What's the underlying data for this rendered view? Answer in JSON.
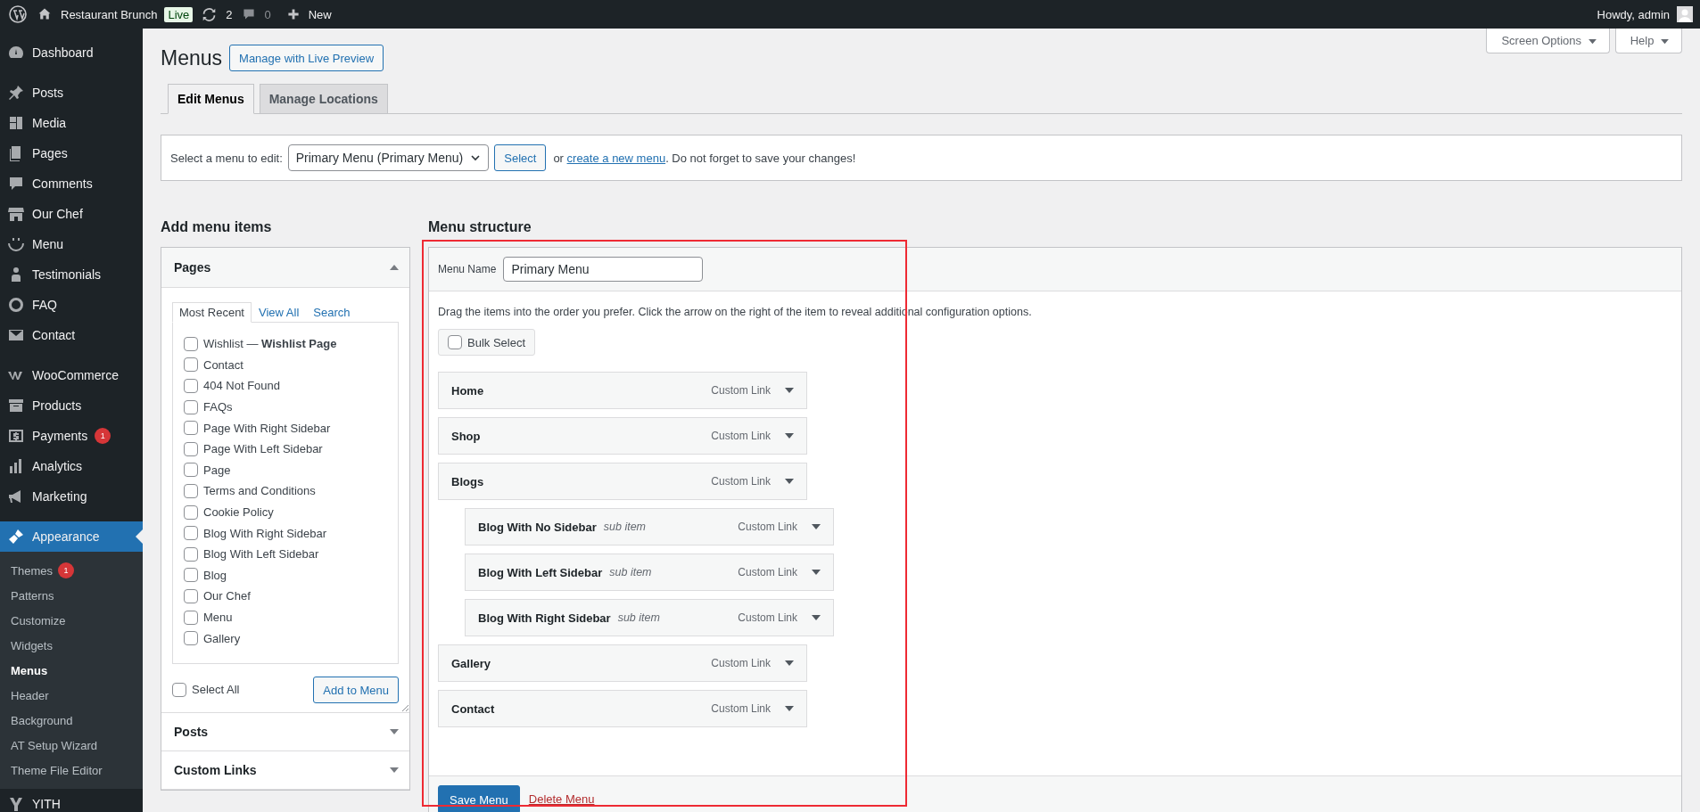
{
  "admin_bar": {
    "site_name": "Restaurant Brunch",
    "live_badge": "Live",
    "updates_count": "2",
    "comments_count": "0",
    "new_label": "New",
    "greeting": "Howdy, admin"
  },
  "sidebar": {
    "sections": [
      {
        "items": [
          {
            "label": "Dashboard",
            "selected": false
          }
        ]
      },
      {
        "items": [
          {
            "label": "Posts",
            "selected": false
          },
          {
            "label": "Media",
            "selected": false
          },
          {
            "label": "Pages",
            "selected": false
          },
          {
            "label": "Comments",
            "selected": false
          },
          {
            "label": "Our Chef",
            "selected": false
          },
          {
            "label": "Menu",
            "selected": false
          },
          {
            "label": "Testimonials",
            "selected": false
          },
          {
            "label": "FAQ",
            "selected": false
          },
          {
            "label": "Contact",
            "selected": false
          }
        ]
      },
      {
        "items": [
          {
            "label": "WooCommerce",
            "selected": false
          },
          {
            "label": "Products",
            "selected": false
          },
          {
            "label": "Payments",
            "badge": "1",
            "selected": false
          },
          {
            "label": "Analytics",
            "selected": false
          },
          {
            "label": "Marketing",
            "selected": false
          }
        ]
      },
      {
        "items": [
          {
            "label": "Appearance",
            "selected": true,
            "children": [
              {
                "label": "Themes",
                "badge": "1",
                "selected": false
              },
              {
                "label": "Patterns",
                "selected": false
              },
              {
                "label": "Customize",
                "selected": false
              },
              {
                "label": "Widgets",
                "selected": false
              },
              {
                "label": "Menus",
                "selected": true
              },
              {
                "label": "Header",
                "selected": false
              },
              {
                "label": "Background",
                "selected": false
              },
              {
                "label": "AT Setup Wizard",
                "selected": false
              },
              {
                "label": "Theme File Editor",
                "selected": false
              }
            ]
          },
          {
            "label": "YITH",
            "selected": false
          }
        ]
      }
    ]
  },
  "screen_options": "Screen Options",
  "help": "Help",
  "page_title": "Menus",
  "live_preview_button": "Manage with Live Preview",
  "tabs": [
    {
      "label": "Edit Menus",
      "selected": true
    },
    {
      "label": "Manage Locations",
      "selected": false
    }
  ],
  "menu_selector": {
    "label": "Select a menu to edit:",
    "value": "Primary Menu (Primary Menu)",
    "button": "Select",
    "note_before": "or",
    "link": "create a new menu",
    "note_after": ". Do not forget to save your changes!"
  },
  "add_menu_items": {
    "title": "Add menu items",
    "panels": [
      {
        "title": "Pages",
        "expanded": true,
        "tabs": [
          {
            "label": "Most Recent",
            "selected": true
          },
          {
            "label": "View All",
            "selected": false
          },
          {
            "label": "Search",
            "selected": false
          }
        ],
        "items": [
          {
            "label": "Wishlist — **Wishlist Page**",
            "checked": false
          },
          {
            "label": "Contact",
            "checked": false
          },
          {
            "label": "404 Not Found",
            "checked": false
          },
          {
            "label": "FAQs",
            "checked": false
          },
          {
            "label": "Page With Right Sidebar",
            "checked": false
          },
          {
            "label": "Page With Left Sidebar",
            "checked": false
          },
          {
            "label": "Page",
            "checked": false
          },
          {
            "label": "Terms and Conditions",
            "checked": false
          },
          {
            "label": "Cookie Policy",
            "checked": false
          },
          {
            "label": "Blog With Right Sidebar",
            "checked": false
          },
          {
            "label": "Blog With Left Sidebar",
            "checked": false
          },
          {
            "label": "Blog",
            "checked": false
          },
          {
            "label": "Our Chef",
            "checked": false
          },
          {
            "label": "Menu",
            "checked": false
          },
          {
            "label": "Gallery",
            "checked": false
          }
        ],
        "select_all": {
          "label": "Select All",
          "checked": false
        },
        "add_button": "Add to Menu"
      },
      {
        "title": "Posts",
        "expanded": false
      },
      {
        "title": "Custom Links",
        "expanded": false
      }
    ]
  },
  "menu_structure": {
    "title": "Menu structure",
    "name_label": "Menu Name",
    "name_value": "Primary Menu",
    "instructions": "Drag the items into the order you prefer. Click the arrow on the right of the item to reveal additional configuration options.",
    "bulk_select": {
      "label": "Bulk Select",
      "checked": false
    },
    "items": [
      {
        "title": "Home",
        "type": "Custom Link"
      },
      {
        "title": "Shop",
        "type": "Custom Link"
      },
      {
        "title": "Blogs",
        "type": "Custom Link",
        "children": [
          {
            "title": "Blog With No Sidebar",
            "note": "sub item",
            "type": "Custom Link"
          },
          {
            "title": "Blog With Left Sidebar",
            "note": "sub item",
            "type": "Custom Link"
          },
          {
            "title": "Blog With Right Sidebar",
            "note": "sub item",
            "type": "Custom Link"
          }
        ]
      },
      {
        "title": "Gallery",
        "type": "Custom Link"
      },
      {
        "title": "Contact",
        "type": "Custom Link"
      }
    ],
    "save_button": "Save Menu",
    "delete_link": "Delete Menu"
  }
}
